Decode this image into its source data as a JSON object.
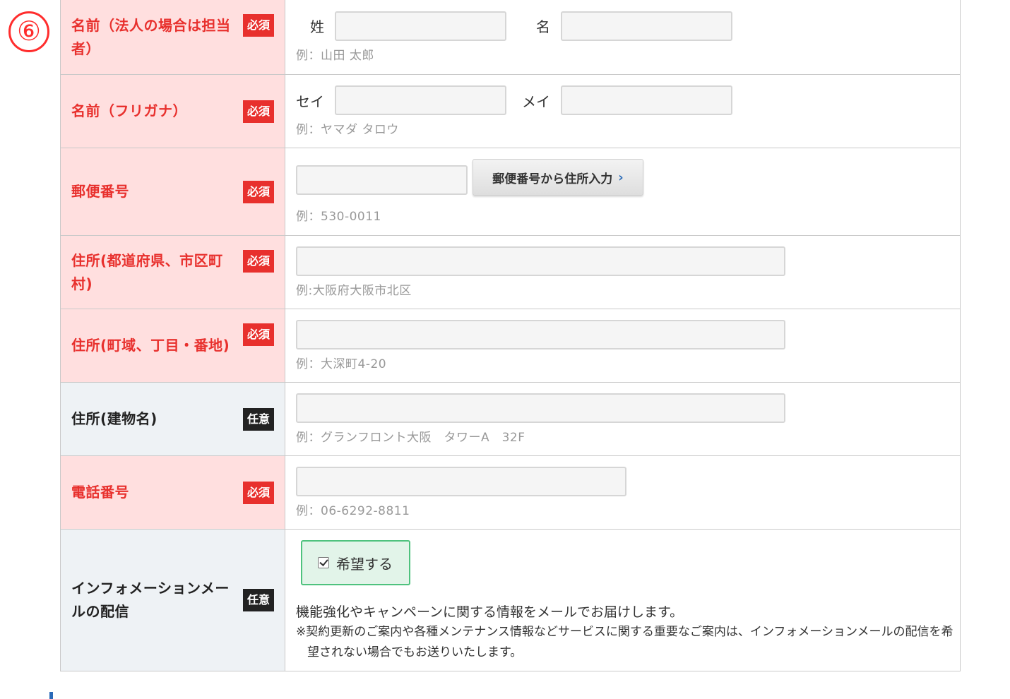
{
  "step_marker": "⑥",
  "rows": {
    "name": {
      "label": "名前（法人の場合は担当者）",
      "badge": "必須",
      "last_label": "姓",
      "first_label": "名",
      "hint": "例：山田 太郎"
    },
    "kana": {
      "label": "名前（フリガナ）",
      "badge": "必須",
      "last_label": "セイ",
      "first_label": "メイ",
      "hint": "例：ヤマダ タロウ"
    },
    "zip": {
      "label": "郵便番号",
      "badge": "必須",
      "button_label": "郵便番号から住所入力",
      "button_icon": "chevron-right",
      "hint": "例：530-0011"
    },
    "address1": {
      "label": "住所(都道府県、市区町村)",
      "badge": "必須",
      "hint": "例:大阪府大阪市北区"
    },
    "address2": {
      "label": "住所(町域、丁目・番地)",
      "badge": "必須",
      "hint": "例：大深町4-20"
    },
    "building": {
      "label": "住所(建物名)",
      "badge": "任意",
      "hint": "例：グランフロント大阪　タワーA　32F"
    },
    "phone": {
      "label": "電話番号",
      "badge": "必須",
      "hint": "例：06-6292-8811"
    },
    "newsletter": {
      "label": "インフォメーションメールの配信",
      "badge": "任意",
      "checkbox_label": "希望する",
      "checked": true,
      "info": "機能強化やキャンペーンに関する情報をメールでお届けします。",
      "note": "※契約更新のご案内や各種メンテナンス情報などサービスに関する重要なご案内は、インフォメーションメールの配信を希望されない場合でもお送りいたします。"
    }
  },
  "colors": {
    "required": "#e8302d",
    "required_bg": "#ffdfdf",
    "optional_bg": "#eef2f5",
    "check_border": "#4fc27e",
    "accent_blue": "#2a6ab8"
  }
}
